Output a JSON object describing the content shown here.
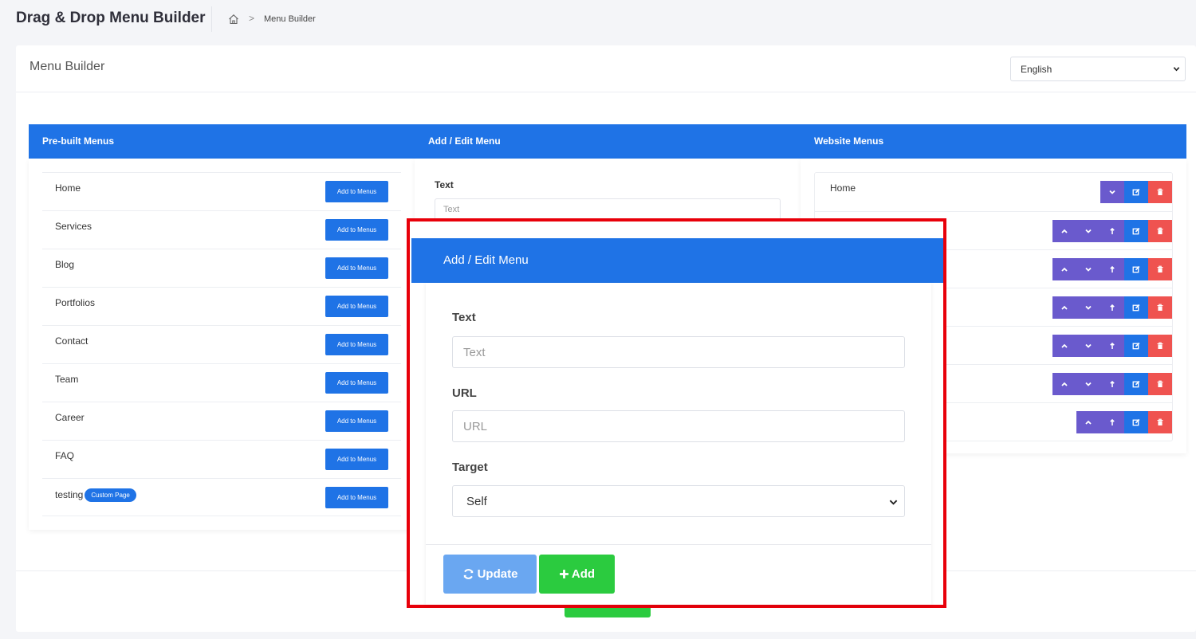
{
  "header": {
    "title": "Drag & Drop Menu Builder",
    "breadcrumb_current": "Menu Builder",
    "breadcrumb_separator": ">"
  },
  "card": {
    "title": "Menu Builder",
    "language_selected": "English"
  },
  "prebuilt": {
    "heading": "Pre-built Menus",
    "add_label": "Add to Menus",
    "items": [
      {
        "label": "Home",
        "badge": ""
      },
      {
        "label": "Services",
        "badge": ""
      },
      {
        "label": "Blog",
        "badge": ""
      },
      {
        "label": "Portfolios",
        "badge": ""
      },
      {
        "label": "Contact",
        "badge": ""
      },
      {
        "label": "Team",
        "badge": ""
      },
      {
        "label": "Career",
        "badge": ""
      },
      {
        "label": "FAQ",
        "badge": ""
      },
      {
        "label": "testing",
        "badge": "Custom Page"
      }
    ]
  },
  "addedit": {
    "heading": "Add / Edit Menu",
    "text_label": "Text",
    "text_placeholder": "Text"
  },
  "website": {
    "heading": "Website Menus",
    "items": [
      {
        "label": "Home",
        "buttons": [
          "down",
          "edit",
          "delete"
        ]
      },
      {
        "label": "",
        "buttons": [
          "up",
          "down",
          "outdent",
          "edit",
          "delete"
        ]
      },
      {
        "label": "",
        "buttons": [
          "up",
          "down",
          "outdent",
          "edit",
          "delete"
        ]
      },
      {
        "label": "",
        "buttons": [
          "up",
          "down",
          "outdent",
          "edit",
          "delete"
        ]
      },
      {
        "label": "",
        "buttons": [
          "up",
          "down",
          "outdent",
          "edit",
          "delete"
        ]
      },
      {
        "label": "",
        "buttons": [
          "up",
          "down",
          "outdent",
          "edit",
          "delete"
        ]
      },
      {
        "label": "",
        "buttons": [
          "up",
          "outdent",
          "edit",
          "delete"
        ]
      }
    ]
  },
  "modal": {
    "title": "Add / Edit Menu",
    "text_label": "Text",
    "text_placeholder": "Text",
    "url_label": "URL",
    "url_placeholder": "URL",
    "target_label": "Target",
    "target_selected": "Self",
    "update_label": "Update",
    "add_label": "Add"
  },
  "colors": {
    "primary": "#1f73e6",
    "success": "#2bcb3f",
    "danger": "#ef5350",
    "purple": "#6a5acd",
    "highlight_border": "#e8000a"
  }
}
